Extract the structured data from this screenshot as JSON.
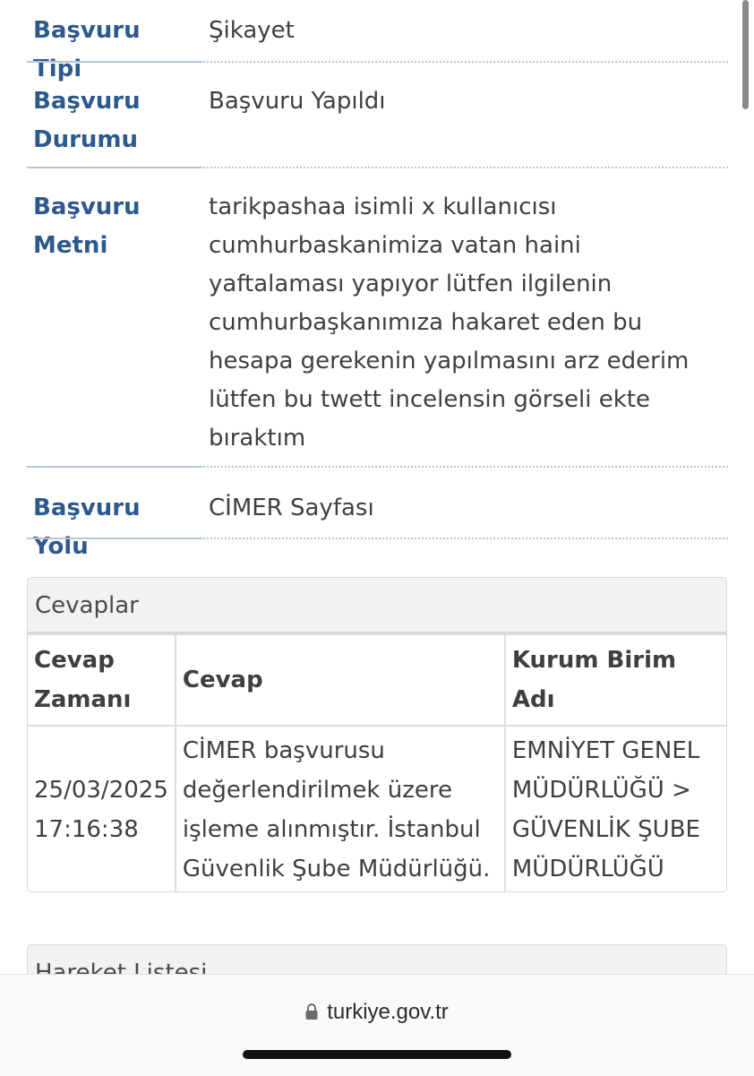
{
  "details": [
    {
      "label": "Başvuru Tipi",
      "value": "Şikayet"
    },
    {
      "label": "Başvuru Durumu",
      "value": "Başvuru Yapıldı"
    },
    {
      "label": "Başvuru Metni",
      "value": "tarikpashaa isimli x kullanıcısı cumhurbaskanimiza vatan haini yaftalaması yapıyor lütfen ilgilenin cumhurbaşkanımıza hakaret eden bu hesapa gerekenin yapılmasını arz ederim lütfen bu twett incelensin görseli ekte bıraktım"
    },
    {
      "label": "Başvuru Yolu",
      "value": "CİMER Sayfası"
    }
  ],
  "answers": {
    "title": "Cevaplar",
    "headers": [
      "Cevap Zamanı",
      "Cevap",
      "Kurum Birim Adı"
    ],
    "rows": [
      [
        "25/03/2025 17:16:38",
        "CİMER başvurusu değerlendirilmek üzere işleme alınmıştır. İstanbul Güvenlik Şube Müdürlüğü.",
        "EMNİYET GENEL MÜDÜRLÜĞÜ > GÜVENLİK ŞUBE MÜDÜRLÜĞÜ"
      ]
    ]
  },
  "movements": {
    "title": "Hareket Listesi"
  },
  "browser": {
    "url": "turkiye.gov.tr",
    "lock_icon": "lock-icon"
  }
}
